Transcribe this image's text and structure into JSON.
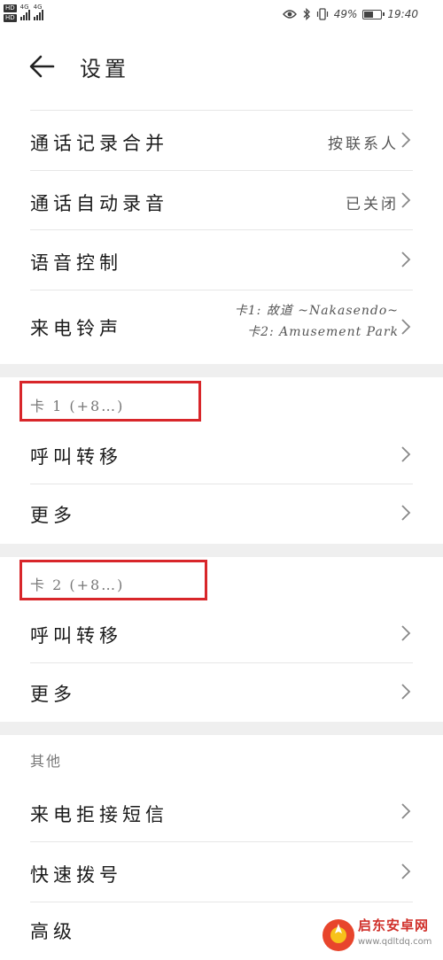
{
  "status_bar": {
    "hd_labels": [
      "HD",
      "HD"
    ],
    "signal_labels": [
      "4G",
      "4G"
    ],
    "battery_percent": "49%",
    "battery_level": 0.49,
    "time": "19:40"
  },
  "header": {
    "title": "设置"
  },
  "rows": {
    "merge_call_log": {
      "label": "通话记录合并",
      "value": "按联系人"
    },
    "auto_record": {
      "label": "通话自动录音",
      "value": "已关闭"
    },
    "voice_control": {
      "label": "语音控制"
    },
    "ringtone": {
      "label": "来电铃声",
      "card1": "卡1: 故道 ~Nakasendo~",
      "card2": "卡2: Amusement Park"
    }
  },
  "card1": {
    "header": "卡 1 (+8…)",
    "forward_label": "呼叫转移",
    "more_label": "更多"
  },
  "card2": {
    "header": "卡 2 (+8…)",
    "forward_label": "呼叫转移",
    "more_label": "更多"
  },
  "others": {
    "header": "其他",
    "reject_sms_label": "来电拒接短信",
    "speed_dial_label": "快速拨号",
    "advanced_label": "高级"
  },
  "watermark": {
    "text": "启东安卓网",
    "url": "www.qdltdq.com"
  },
  "colors": {
    "highlight_box": "#d8262a",
    "section_gap": "#efefef",
    "watermark": "#d0302a"
  }
}
